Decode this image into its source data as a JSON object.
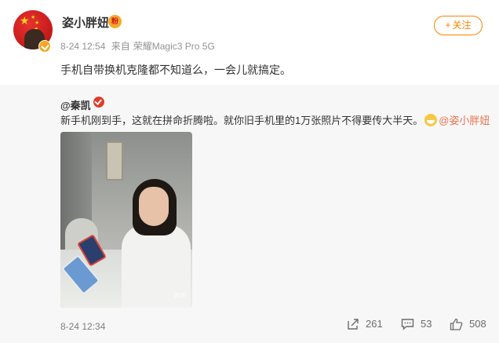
{
  "post": {
    "username": "姿小胖妞",
    "fan_badge": "粉",
    "time": "8-24 12:54",
    "source_prefix": "来自",
    "source_device": "荣耀Magic3 Pro 5G",
    "follow_label": "关注",
    "follow_plus": "+",
    "text": "手机自带换机克隆都不知道么，一会儿就搞定。"
  },
  "repost": {
    "user": "@秦凯",
    "text": "新手机刚到手，这就在拼命折腾啦。就你旧手机里的1万张照片不得要传大半天。",
    "mention": "@姿小胖妞",
    "watermark": "微博"
  },
  "footer": {
    "time": "8-24 12:34",
    "share_count": "261",
    "comment_count": "53",
    "like_count": "508"
  },
  "colors": {
    "accent_orange": "#ff8200",
    "mention": "#eb7350",
    "repost_bg": "#f7f7f7"
  },
  "icons": [
    "avatar-verified-badge",
    "fan-icon",
    "share-icon",
    "comment-icon",
    "like-icon",
    "grin-emoji"
  ]
}
